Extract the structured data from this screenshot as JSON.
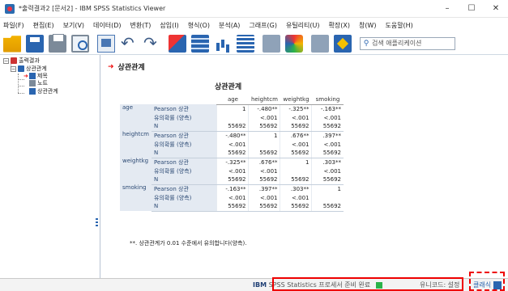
{
  "window": {
    "title": "*출력결과2 [문서2] - IBM SPSS Statistics Viewer",
    "controls": {
      "minimize": "–",
      "maximize": "☐",
      "close": "✕"
    }
  },
  "menu": [
    "파일(F)",
    "편집(E)",
    "보기(V)",
    "데이터(D)",
    "변환(T)",
    "삽입(I)",
    "형식(O)",
    "분석(A)",
    "그래프(G)",
    "유틸리티(U)",
    "확장(X)",
    "창(W)",
    "도움말(H)"
  ],
  "toolbar": {
    "search_placeholder": "검색 애플리케이션",
    "search_icon": "search-icon"
  },
  "outline": {
    "root": "출력결과",
    "node": "상관관계",
    "children": [
      "제목",
      "노트",
      "상관관계"
    ]
  },
  "section": {
    "heading": "상관관계",
    "table_title": "상관관계"
  },
  "table": {
    "columns": [
      "age",
      "heightcm",
      "weightkg",
      "smoking"
    ],
    "row_groups": [
      {
        "var": "age",
        "rows": [
          {
            "stat": "Pearson 상관",
            "values": [
              "1",
              "-.480**",
              "-.325**",
              "-.163**"
            ]
          },
          {
            "stat": "유의확률 (양측)",
            "values": [
              "",
              "<.001",
              "<.001",
              "<.001"
            ]
          },
          {
            "stat": "N",
            "values": [
              "55692",
              "55692",
              "55692",
              "55692"
            ]
          }
        ]
      },
      {
        "var": "heightcm",
        "rows": [
          {
            "stat": "Pearson 상관",
            "values": [
              "-.480**",
              "1",
              ".676**",
              ".397**"
            ]
          },
          {
            "stat": "유의확률 (양측)",
            "values": [
              "<.001",
              "",
              "<.001",
              "<.001"
            ]
          },
          {
            "stat": "N",
            "values": [
              "55692",
              "55692",
              "55692",
              "55692"
            ]
          }
        ]
      },
      {
        "var": "weightkg",
        "rows": [
          {
            "stat": "Pearson 상관",
            "values": [
              "-.325**",
              ".676**",
              "1",
              ".303**"
            ]
          },
          {
            "stat": "유의확률 (양측)",
            "values": [
              "<.001",
              "<.001",
              "",
              "<.001"
            ]
          },
          {
            "stat": "N",
            "values": [
              "55692",
              "55692",
              "55692",
              "55692"
            ]
          }
        ]
      },
      {
        "var": "smoking",
        "rows": [
          {
            "stat": "Pearson 상관",
            "values": [
              "-.163**",
              ".397**",
              ".303**",
              "1"
            ]
          },
          {
            "stat": "유의확률 (양측)",
            "values": [
              "<.001",
              "<.001",
              "<.001",
              ""
            ]
          },
          {
            "stat": "N",
            "values": [
              "55692",
              "55692",
              "55692",
              "55692"
            ]
          }
        ]
      }
    ],
    "footnote": "**. 상관관계가 0.01 수준에서 유의합니다(양측)."
  },
  "status": {
    "ibm": "IBM",
    "processor": "SPSS Statistics 프로세서 준비 완료",
    "unicode": "유니코드: 설정",
    "classic": "클래식"
  },
  "colors": {
    "accent": "#2a65b0",
    "label_bg": "#e4eaf2",
    "highlight": "#e00000"
  }
}
